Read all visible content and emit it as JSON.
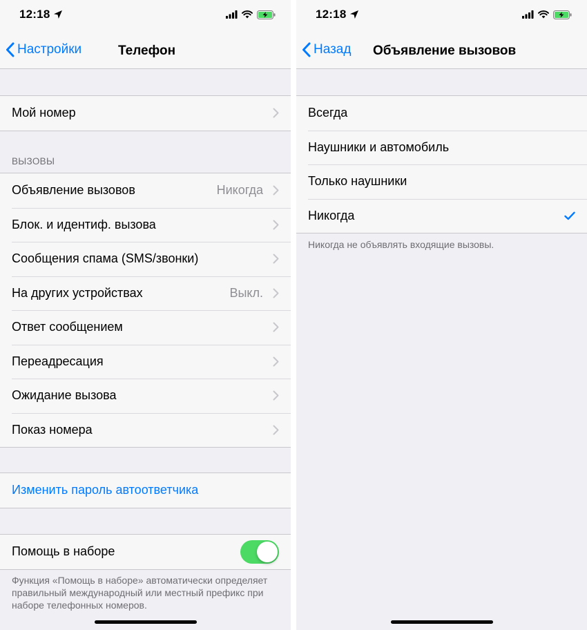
{
  "left": {
    "status": {
      "time": "12:18"
    },
    "nav": {
      "back_label": "Настройки",
      "title": "Телефон"
    },
    "my_number": {
      "label": "Мой номер"
    },
    "calls_header": "ВЫЗОВЫ",
    "calls_items": [
      {
        "label": "Объявление вызовов",
        "value": "Никогда"
      },
      {
        "label": "Блок. и идентиф. вызова",
        "value": ""
      },
      {
        "label": "Сообщения спама (SMS/звонки)",
        "value": ""
      },
      {
        "label": "На других устройствах",
        "value": "Выкл."
      },
      {
        "label": "Ответ сообщением",
        "value": ""
      },
      {
        "label": "Переадресация",
        "value": ""
      },
      {
        "label": "Ожидание вызова",
        "value": ""
      },
      {
        "label": "Показ номера",
        "value": ""
      }
    ],
    "change_password": {
      "label": "Изменить пароль автоответчика"
    },
    "dial_assist": {
      "label": "Помощь в наборе",
      "enabled": true,
      "footer": "Функция «Помощь в наборе» автоматически определяет правильный международный или местный префикс при наборе телефонных номеров."
    }
  },
  "right": {
    "status": {
      "time": "12:18"
    },
    "nav": {
      "back_label": "Назад",
      "title": "Объявление вызовов"
    },
    "options": [
      {
        "label": "Всегда",
        "selected": false
      },
      {
        "label": "Наушники и автомобиль",
        "selected": false
      },
      {
        "label": "Только наушники",
        "selected": false
      },
      {
        "label": "Никогда",
        "selected": true
      }
    ],
    "footer": "Никогда не объявлять входящие вызовы."
  },
  "icons": {
    "location": "location-arrow-icon",
    "signal": "cellular-signal-icon",
    "wifi": "wifi-icon",
    "battery": "battery-charging-icon",
    "back": "chevron-left-icon",
    "disclosure": "chevron-right-icon",
    "check": "checkmark-icon"
  },
  "colors": {
    "accent": "#007aff",
    "toggle_on": "#4cd964",
    "battery": "#4cd964",
    "background": "#efeff4",
    "cell": "#f7f7f7",
    "secondary_text": "#8e8e93"
  }
}
